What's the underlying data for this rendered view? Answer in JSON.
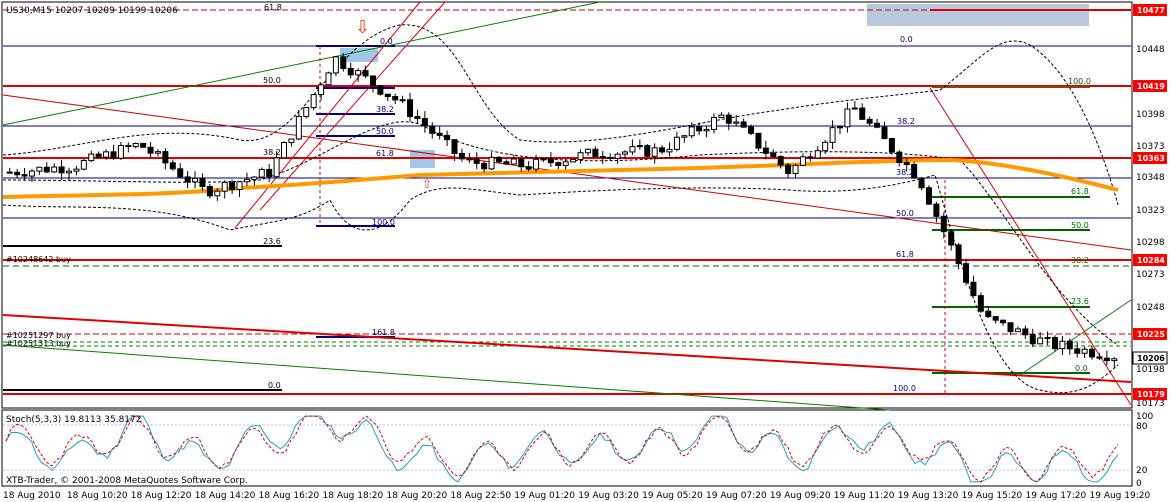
{
  "chart_header": {
    "symbol_line": "US30,M15  10207 10209 10199 10206",
    "signal_arrow": "down-arrow"
  },
  "price_axis": {
    "labels": [
      "10448",
      "10398",
      "10373",
      "10348",
      "10323",
      "10298",
      "10273",
      "10248",
      "10198",
      "10173"
    ],
    "tags": [
      {
        "value": "10477",
        "color": "#ff0000"
      },
      {
        "value": "10419",
        "color": "#ff0000"
      },
      {
        "value": "10363",
        "color": "#ff0000"
      },
      {
        "value": "10284",
        "color": "#ff0000"
      },
      {
        "value": "10225",
        "color": "#ff0000"
      },
      {
        "value": "10206",
        "color": "#ffffff"
      },
      {
        "value": "10179",
        "color": "#ff0000"
      }
    ]
  },
  "time_axis": {
    "labels": [
      "18 Aug 2010",
      "18 Aug 10:20",
      "18 Aug 12:20",
      "18 Aug 14:20",
      "18 Aug 16:20",
      "18 Aug 18:20",
      "18 Aug 20:20",
      "18 Aug 22:50",
      "19 Aug 01:20",
      "19 Aug 03:20",
      "19 Aug 05:20",
      "19 Aug 07:20",
      "19 Aug 09:20",
      "19 Aug 11:20",
      "19 Aug 13:20",
      "19 Aug 15:20",
      "19 Aug 17:20",
      "19 Aug 19:20"
    ]
  },
  "fib_labels": {
    "left": [
      "61.8",
      "0.0",
      "50.0",
      "38.2",
      "50.0",
      "38.2",
      "61.8",
      "100.0",
      "23.6",
      "161.8",
      "0.0"
    ],
    "right": [
      "0.0",
      "100.0",
      "38.2",
      "61.8",
      "50.0",
      "61.8",
      "50.0",
      "38.2",
      "23.6",
      "0.0",
      "100.0"
    ],
    "center": [
      "38.2",
      "50.0",
      "61.8",
      "100.0"
    ]
  },
  "order_labels": {
    "buy1": "#10248642 buy",
    "buy2": "#10251297 buy",
    "buy3": "#10251313 buy"
  },
  "indicator": {
    "title": "Stoch(5,3,3) 19.8113 35.8172",
    "levels": [
      "100",
      "80",
      "20",
      "0"
    ]
  },
  "footer": {
    "copyright": "XTB-Trader, © 2001-2008 MetaQuotes Software Corp."
  },
  "chart_data": {
    "type": "candlestick",
    "symbol": "US30",
    "timeframe": "M15",
    "ohlc_current": {
      "open": 10207,
      "high": 10209,
      "low": 10199,
      "close": 10206
    },
    "x": [
      "18 Aug 2010",
      "18 Aug 10:20",
      "18 Aug 12:20",
      "18 Aug 14:20",
      "18 Aug 16:20",
      "18 Aug 18:20",
      "18 Aug 20:20",
      "18 Aug 22:50",
      "19 Aug 01:20",
      "19 Aug 03:20",
      "19 Aug 05:20",
      "19 Aug 07:20",
      "19 Aug 09:20",
      "19 Aug 11:20",
      "19 Aug 13:20",
      "19 Aug 15:20",
      "19 Aug 17:20",
      "19 Aug 19:20"
    ],
    "close": [
      10350,
      10355,
      10372,
      10335,
      10350,
      10440,
      10405,
      10358,
      10355,
      10365,
      10367,
      10395,
      10350,
      10400,
      10345,
      10235,
      10215,
      10206
    ],
    "horizontal_levels": [
      10477,
      10419,
      10363,
      10284,
      10225,
      10179
    ],
    "ylim": [
      10168,
      10482
    ],
    "stochastic": {
      "k": [
        60,
        35,
        85,
        30,
        70,
        95,
        40,
        25,
        55,
        45,
        60,
        85,
        35,
        75,
        50,
        15,
        30,
        20
      ],
      "d": [
        65,
        45,
        75,
        40,
        60,
        90,
        55,
        30,
        50,
        50,
        55,
        80,
        45,
        70,
        55,
        25,
        30,
        36
      ],
      "last_k": 19.8113,
      "last_d": 35.8172,
      "levels": [
        80,
        20
      ],
      "ylim": [
        0,
        100
      ]
    }
  }
}
